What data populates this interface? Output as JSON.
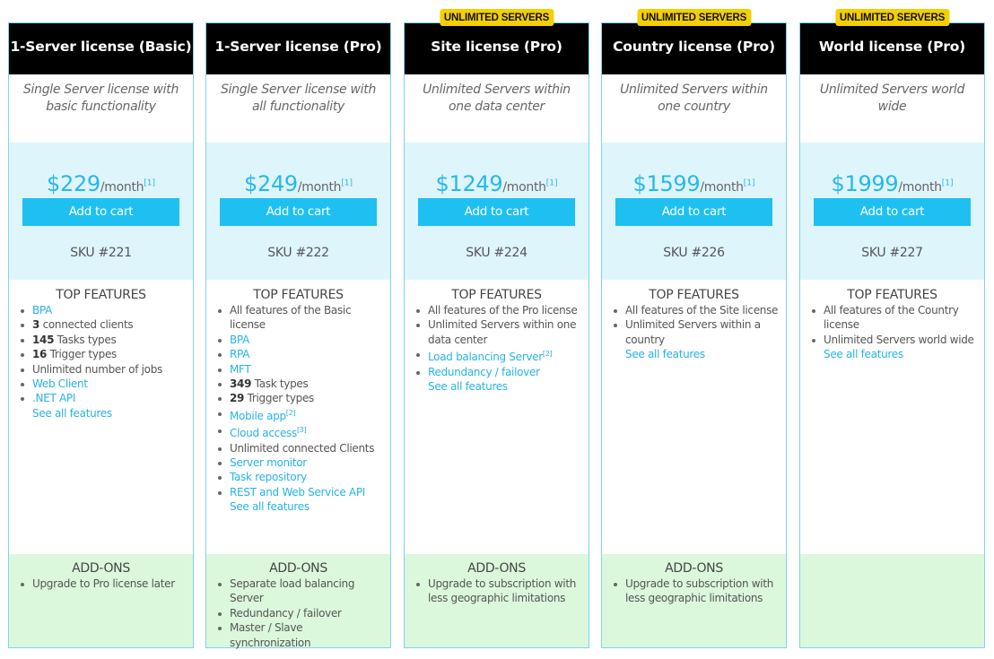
{
  "accent_color": "#1ec0f2",
  "badge_color": "#f5d000",
  "plans": [
    {
      "badge": null,
      "title": "1-Server license (Basic)",
      "description": "Single Server license with basic functionality",
      "price": "$229",
      "period": "/month",
      "footnote": "[1]",
      "cart_label": "Add to cart",
      "sku": "SKU #221",
      "features_title": "TOP FEATURES",
      "features": [
        {
          "text": "BPA",
          "link": true
        },
        {
          "bold": "3",
          "text": " connected clients"
        },
        {
          "bold": "145",
          "text": " Tasks types"
        },
        {
          "bold": "16",
          "text": " Trigger types"
        },
        {
          "text": "Unlimited number of jobs"
        },
        {
          "text": "Web Client",
          "link": true
        },
        {
          "text": ".NET API",
          "link": true
        }
      ],
      "see_all": "See all features",
      "addons_title": "ADD-ONS",
      "addons": [
        "Upgrade to Pro license later"
      ]
    },
    {
      "badge": null,
      "title": "1-Server license (Pro)",
      "description": "Single Server license with all functionality",
      "price": "$249",
      "period": "/month",
      "footnote": "[1]",
      "cart_label": "Add to cart",
      "sku": "SKU #222",
      "features_title": "TOP FEATURES",
      "features": [
        {
          "text": "All features of the Basic license"
        },
        {
          "text": "BPA",
          "link": true
        },
        {
          "text": "RPA",
          "link": true
        },
        {
          "text": "MFT",
          "link": true
        },
        {
          "bold": "349",
          "text": " Task types"
        },
        {
          "bold": "29",
          "text": " Trigger types"
        },
        {
          "text": "Mobile app",
          "link": true,
          "sup": "[2]"
        },
        {
          "text": "Cloud access",
          "link": true,
          "sup": "[3]"
        },
        {
          "text": "Unlimited connected Clients"
        },
        {
          "text": "Server monitor",
          "link": true
        },
        {
          "text": "Task repository",
          "link": true
        },
        {
          "text": "REST and Web Service API",
          "link": true
        }
      ],
      "see_all": "See all features",
      "addons_title": "ADD-ONS",
      "addons": [
        "Separate load balancing Server",
        "Redundancy / failover",
        "Master / Slave synchronization"
      ]
    },
    {
      "badge": "UNLIMITED SERVERS",
      "title": "Site license (Pro)",
      "description": "Unlimited Servers within one data center",
      "price": "$1249",
      "period": "/month",
      "footnote": "[1]",
      "cart_label": "Add to cart",
      "sku": "SKU #224",
      "features_title": "TOP FEATURES",
      "features": [
        {
          "text": "All features of the Pro license"
        },
        {
          "text": "Unlimited Servers within one data center"
        },
        {
          "text": "Load balancing Server",
          "link": true,
          "sup": "[2]"
        },
        {
          "text": "Redundancy / failover",
          "link": true
        }
      ],
      "see_all": "See all features",
      "addons_title": "ADD-ONS",
      "addons": [
        "Upgrade to subscription with less geographic limitations"
      ]
    },
    {
      "badge": "UNLIMITED SERVERS",
      "title": "Country license (Pro)",
      "description": "Unlimited Servers within one country",
      "price": "$1599",
      "period": "/month",
      "footnote": "[1]",
      "cart_label": "Add to cart",
      "sku": "SKU #226",
      "features_title": "TOP FEATURES",
      "features": [
        {
          "text": "All features of the Site license"
        },
        {
          "text": "Unlimited Servers within a country"
        }
      ],
      "see_all": "See all features",
      "addons_title": "ADD-ONS",
      "addons": [
        "Upgrade to subscription with less geographic limitations"
      ]
    },
    {
      "badge": "UNLIMITED SERVERS",
      "title": "World license (Pro)",
      "description": "Unlimited Servers world wide",
      "price": "$1999",
      "period": "/month",
      "footnote": "[1]",
      "cart_label": "Add to cart",
      "sku": "SKU #227",
      "features_title": "TOP FEATURES",
      "features": [
        {
          "text": "All features of the Country license"
        },
        {
          "text": "Unlimited Servers world wide"
        }
      ],
      "see_all": "See all features",
      "addons_title": null,
      "addons": []
    }
  ]
}
